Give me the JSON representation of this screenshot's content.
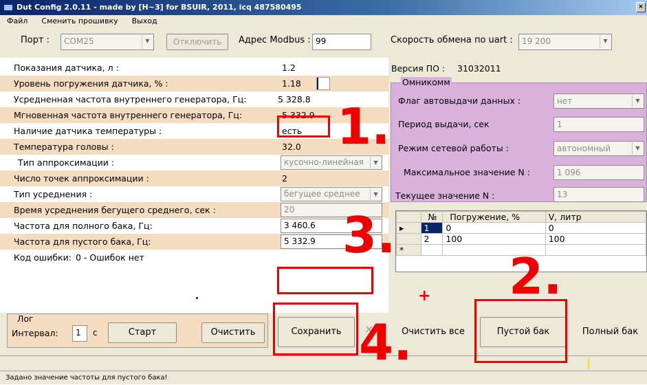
{
  "window": {
    "title": "Dut Config 2.0.11 - made by [H~3] for BSUIR, 2011, icq 487580495",
    "close_glyph": "×"
  },
  "menu": [
    "Файл",
    "Сменить прошивку",
    "Выход"
  ],
  "toolbar": {
    "port_label": "Порт :",
    "port_value": "COM25",
    "disconnect_label": "Отключить",
    "modbus_label": "Адрес Modbus :",
    "modbus_value": "99",
    "uart_label": "Скорость обмена по uart :",
    "uart_value": "19 200"
  },
  "params": [
    {
      "label": "Показания датчика, л :",
      "value": "1.2"
    },
    {
      "label": "Уровень погружения датчика, % :",
      "value": "1.18",
      "level": 0.12
    },
    {
      "label": "Усредненная частота внутреннего генератора, Гц:",
      "value": "5 328.8"
    },
    {
      "label": "Мгновенная частота внутреннего генератора, Гц:",
      "value": "5 332.9"
    },
    {
      "label": "Наличие датчика температуры :",
      "value": "есть"
    },
    {
      "label": "Температура головы :",
      "value": "32.0"
    },
    {
      "label": "Тип аппроксимации :",
      "value": "кусочно-линейная"
    },
    {
      "label": "Число точек аппроксимации :",
      "value": "2"
    },
    {
      "label": "Тип усреднения :",
      "value": "бегущее среднее"
    },
    {
      "label": "Время усреднения бегущего среднего, сек :",
      "value": "20"
    },
    {
      "label": "Частота для полного бака, Гц:",
      "value": "3 460.6"
    },
    {
      "label": "Частота для пустого бака, Гц:",
      "value": "5 332.9"
    },
    {
      "label": "Код ошибки:",
      "value": "0 - Ошибок нет"
    }
  ],
  "firmware": {
    "label": "Версия ПО :",
    "value": "31032011"
  },
  "omnicomm": {
    "title": "Омникомм",
    "auto_label": "Флаг автовыдачи данных :",
    "auto_value": "нет",
    "period_label": "Период выдачи, сек",
    "period_value": "1",
    "network_label": "Режим сетевой работы :",
    "network_value": "автономный",
    "max_label": "Максимальное значение N :",
    "max_value": "1 096",
    "current_label": "Текущее значение N :",
    "current_value": "13"
  },
  "table": {
    "headers": [
      "№",
      "Погружение, %",
      "V, литр"
    ],
    "rows": [
      [
        "1",
        "0",
        "0"
      ],
      [
        "2",
        "100",
        "100"
      ]
    ],
    "row_marker": "▸",
    "new_marker": "*"
  },
  "log": {
    "title": "Лог",
    "interval_label": "Интервал:",
    "interval_value": "1",
    "unit": "с",
    "start_label": "Старт",
    "clear_label": "Очистить"
  },
  "actions": {
    "save_label": "Сохранить",
    "x_label": "×",
    "clear_all_label": "Очистить все",
    "empty_label": "Пустой бак",
    "full_label": "Полный бак"
  },
  "annotations": {
    "one": "1.",
    "two": "2.",
    "three": "3.",
    "four": "4.",
    "plus": "+"
  },
  "status": "Задано значение частоты для пустого бака!",
  "colors": {
    "tan": "#f3dcbf",
    "lilac": "#d9b2dc",
    "red": "#e00000",
    "level_bar": "#0b1f6b"
  }
}
